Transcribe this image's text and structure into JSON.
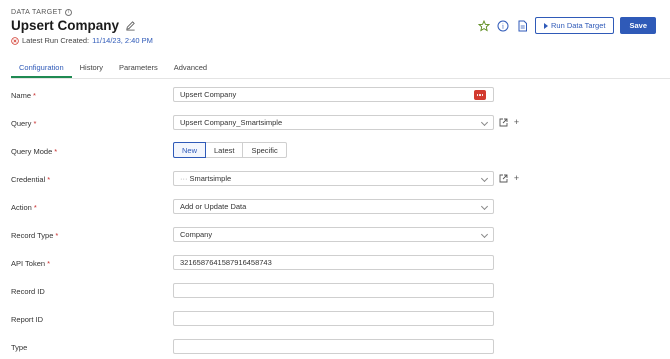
{
  "header": {
    "eyebrow": "DATA TARGET",
    "info_glyph": "i",
    "title": "Upsert Company",
    "last_run_label": "Latest Run Created:",
    "last_run_date": "11/14/23, 2:40 PM"
  },
  "actions": {
    "run_label": "Run Data Target",
    "save_label": "Save",
    "info_glyph": "i"
  },
  "tabs": [
    {
      "label": "Configuration",
      "active": true
    },
    {
      "label": "History",
      "active": false
    },
    {
      "label": "Parameters",
      "active": false
    },
    {
      "label": "Advanced",
      "active": false
    }
  ],
  "form": {
    "name": {
      "label": "Name",
      "required": "*",
      "value": "Upsert Company"
    },
    "query": {
      "label": "Query",
      "required": "*",
      "value": "Upsert Company_Smartsimple"
    },
    "query_mode": {
      "label": "Query Mode",
      "required": "*",
      "options": [
        "New",
        "Latest",
        "Specific"
      ],
      "selected": "New"
    },
    "credential": {
      "label": "Credential",
      "required": "*",
      "value": "Smartsimple",
      "prefix": "···"
    },
    "action": {
      "label": "Action",
      "required": "*",
      "value": "Add or Update Data"
    },
    "record_type": {
      "label": "Record Type",
      "required": "*",
      "value": "Company"
    },
    "api_token": {
      "label": "API Token",
      "required": "*",
      "value": "3216587641587916458743"
    },
    "record_id": {
      "label": "Record ID",
      "value": ""
    },
    "report_id": {
      "label": "Report ID",
      "value": ""
    },
    "type": {
      "label": "Type",
      "value": ""
    }
  },
  "icons": {
    "plus": "+"
  },
  "colors": {
    "accent": "#2f5ab8",
    "tab_underline": "#1f8a52",
    "required": "#c62828",
    "error": "#d23a2f",
    "star": "#5a8a1a"
  }
}
